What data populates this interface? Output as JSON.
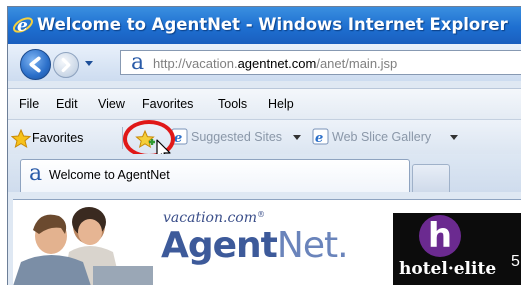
{
  "window": {
    "title": "Welcome to AgentNet - Windows Internet Explorer"
  },
  "address_bar": {
    "url_prefix": "http://vacation.",
    "url_domain": "agentnet.com",
    "url_suffix": "/anet/main.jsp"
  },
  "menu": {
    "items": [
      "File",
      "Edit",
      "View",
      "Favorites",
      "Tools",
      "Help"
    ]
  },
  "favorites_bar": {
    "favorites_label": "Favorites",
    "suggested_sites_label": "Suggested Sites",
    "web_slice_gallery_label": "Web Slice Gallery"
  },
  "tabs": {
    "active_label": "Welcome to AgentNet"
  },
  "content": {
    "logo_small": "vacation.com",
    "logo_tm": "®",
    "logo_agent_bold": "Agent",
    "logo_agent_light": "Net.",
    "hotel_letter": "h",
    "hotel_text": "hotel·elite",
    "hotel_num": "5"
  },
  "colors": {
    "title_bar": "#1e6fd0",
    "highlight": "#e01818",
    "brand": "#3d5a9a"
  }
}
